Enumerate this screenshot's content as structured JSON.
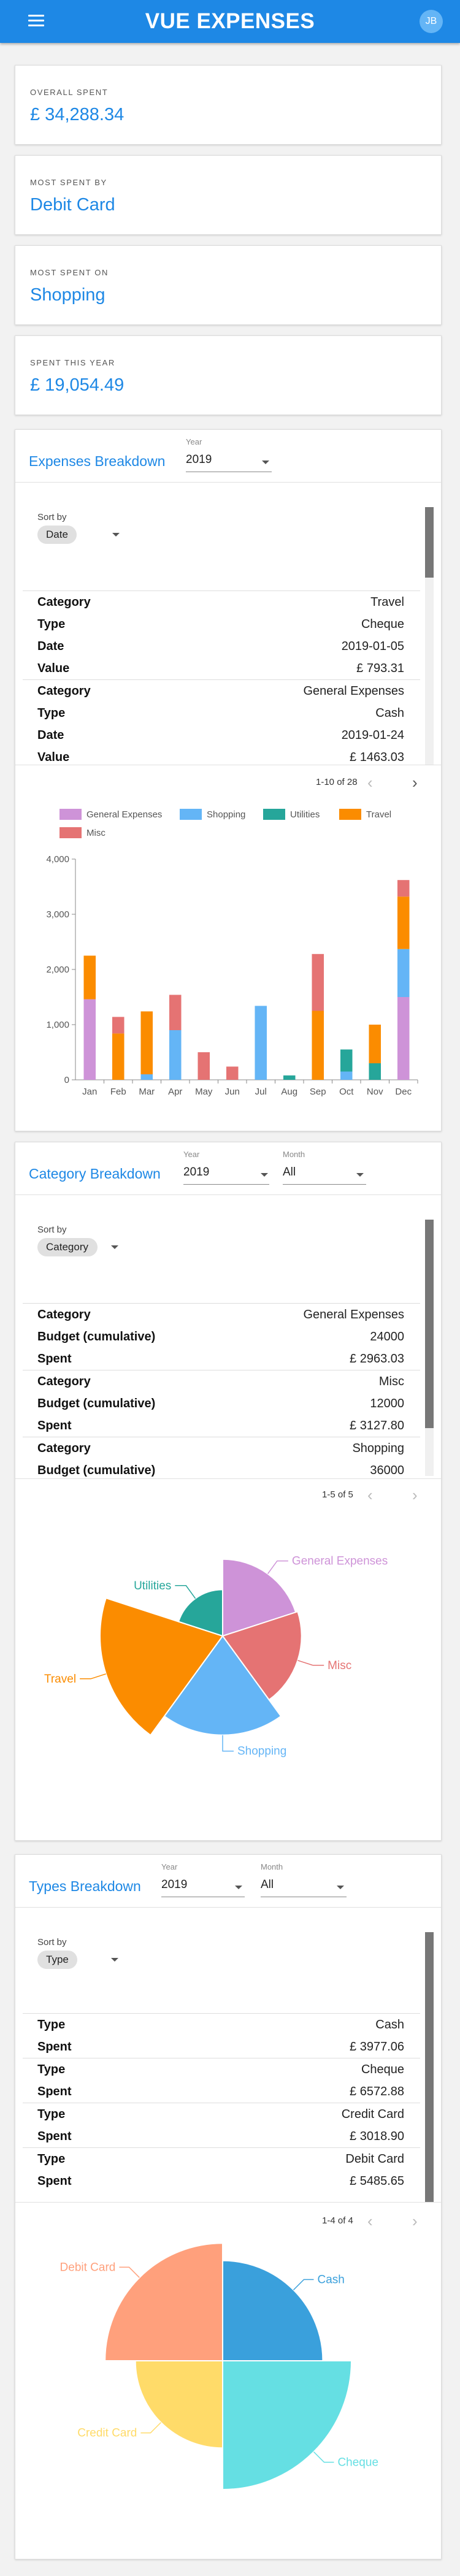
{
  "header": {
    "title": "VUE EXPENSES",
    "avatar_initials": "JB",
    "bar_color": "#1e88e5"
  },
  "stats": [
    {
      "label": "OVERALL SPENT",
      "value": "£ 34,288.34"
    },
    {
      "label": "MOST SPENT BY",
      "value": "Debit Card"
    },
    {
      "label": "MOST SPENT ON",
      "value": "Shopping"
    },
    {
      "label": "SPENT THIS YEAR",
      "value": "£ 19,054.49"
    }
  ],
  "expenses_panel": {
    "title": "Expenses Breakdown",
    "year_label": "Year",
    "year_value": "2019",
    "sort_label": "Sort by",
    "sort_value": "Date",
    "rows": [
      [
        [
          "Category",
          "Travel"
        ],
        [
          "Type",
          "Cheque"
        ],
        [
          "Date",
          "2019-01-05"
        ],
        [
          "Value",
          "£ 793.31"
        ]
      ],
      [
        [
          "Category",
          "General Expenses"
        ],
        [
          "Type",
          "Cash"
        ],
        [
          "Date",
          "2019-01-24"
        ],
        [
          "Value",
          "£ 1463.03"
        ]
      ]
    ],
    "pagination": "1-10 of 28"
  },
  "category_panel": {
    "title": "Category Breakdown",
    "year_label": "Year",
    "year_value": "2019",
    "month_label": "Month",
    "month_value": "All",
    "sort_label": "Sort by",
    "sort_value": "Category",
    "rows": [
      [
        [
          "Category",
          "General Expenses"
        ],
        [
          "Budget (cumulative)",
          "24000"
        ],
        [
          "Spent",
          "£ 2963.03"
        ]
      ],
      [
        [
          "Category",
          "Misc"
        ],
        [
          "Budget (cumulative)",
          "12000"
        ],
        [
          "Spent",
          "£ 3127.80"
        ]
      ],
      [
        [
          "Category",
          "Shopping"
        ],
        [
          "Budget (cumulative)",
          "36000"
        ]
      ]
    ],
    "pagination": "1-5 of 5"
  },
  "types_panel": {
    "title": "Types Breakdown",
    "year_label": "Year",
    "year_value": "2019",
    "month_label": "Month",
    "month_value": "All",
    "sort_label": "Sort by",
    "sort_value": "Type",
    "rows": [
      [
        [
          "Type",
          "Cash"
        ],
        [
          "Spent",
          "£ 3977.06"
        ]
      ],
      [
        [
          "Type",
          "Cheque"
        ],
        [
          "Spent",
          "£ 6572.88"
        ]
      ],
      [
        [
          "Type",
          "Credit Card"
        ],
        [
          "Spent",
          "£ 3018.90"
        ]
      ],
      [
        [
          "Type",
          "Debit Card"
        ],
        [
          "Spent",
          "£ 5485.65"
        ]
      ]
    ],
    "pagination": "1-4 of 4"
  },
  "chart_data": [
    {
      "type": "bar",
      "stacked": true,
      "categories": [
        "Jan",
        "Feb",
        "Mar",
        "Apr",
        "May",
        "Jun",
        "Jul",
        "Aug",
        "Sep",
        "Oct",
        "Nov",
        "Dec"
      ],
      "ylim": [
        0,
        4000
      ],
      "yticks": [
        "0",
        "1,000",
        "2,000",
        "3,000",
        "4,000"
      ],
      "legend_position": "top",
      "grid": false,
      "series": [
        {
          "name": "General Expenses",
          "color": "#ce93d8",
          "values": [
            1460,
            0,
            0,
            0,
            0,
            0,
            0,
            0,
            0,
            0,
            0,
            1500
          ]
        },
        {
          "name": "Shopping",
          "color": "#64b5f6",
          "values": [
            0,
            0,
            100,
            900,
            0,
            0,
            1340,
            0,
            0,
            150,
            0,
            870
          ]
        },
        {
          "name": "Utilities",
          "color": "#26a69a",
          "values": [
            0,
            0,
            0,
            0,
            0,
            0,
            0,
            80,
            0,
            400,
            300,
            0
          ]
        },
        {
          "name": "Travel",
          "color": "#fb8c00",
          "values": [
            790,
            840,
            1140,
            0,
            0,
            0,
            0,
            0,
            1250,
            0,
            700,
            950
          ]
        },
        {
          "name": "Misc",
          "color": "#e57373",
          "values": [
            0,
            300,
            0,
            640,
            500,
            240,
            0,
            0,
            1030,
            0,
            0,
            300
          ]
        }
      ]
    },
    {
      "type": "pie",
      "variant": "polar-area",
      "slices": [
        {
          "label": "General Expenses",
          "value": 2963.03,
          "color": "#ce93d8"
        },
        {
          "label": "Misc",
          "value": 3127.8,
          "color": "#e57373"
        },
        {
          "label": "Shopping",
          "value": 4935,
          "color": "#64b5f6"
        },
        {
          "label": "Travel",
          "value": 7550,
          "color": "#fb8c00"
        },
        {
          "label": "Utilities",
          "value": 1078,
          "color": "#26a69a"
        }
      ]
    },
    {
      "type": "pie",
      "variant": "polar-area",
      "slices": [
        {
          "label": "Cash",
          "value": 3977.06,
          "color": "#3aa0dc"
        },
        {
          "label": "Cheque",
          "value": 6572.88,
          "color": "#65dfe3"
        },
        {
          "label": "Credit Card",
          "value": 3018.9,
          "color": "#ffdb69"
        },
        {
          "label": "Debit Card",
          "value": 5485.65,
          "color": "#ffa07c"
        }
      ]
    }
  ]
}
